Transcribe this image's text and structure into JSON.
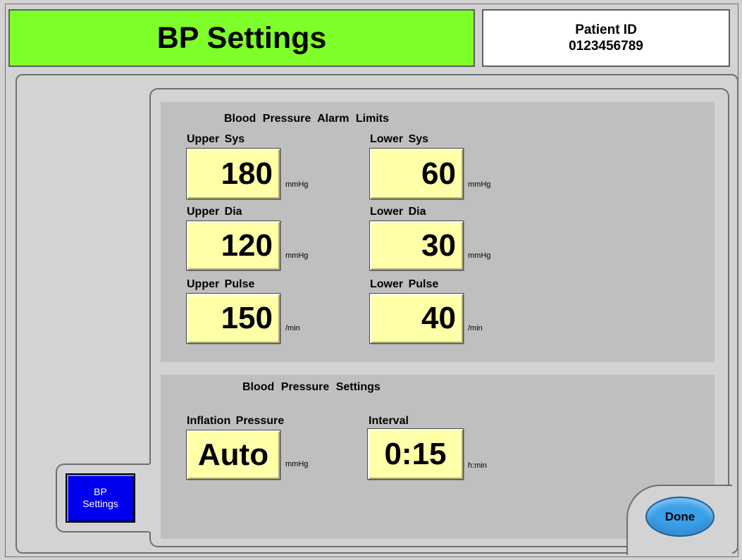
{
  "header": {
    "title": "BP Settings",
    "patient_id_label": "Patient ID",
    "patient_id_value": "0123456789"
  },
  "alarm_limits": {
    "section_title": "Blood  Pressure  Alarm  Limits",
    "upper_sys": {
      "label": "Upper Sys",
      "value": "180",
      "unit": "mmHg"
    },
    "lower_sys": {
      "label": "Lower Sys",
      "value": "60",
      "unit": "mmHg"
    },
    "upper_dia": {
      "label": "Upper Dia",
      "value": "120",
      "unit": "mmHg"
    },
    "lower_dia": {
      "label": "Lower Dia",
      "value": "30",
      "unit": "mmHg"
    },
    "upper_pulse": {
      "label": "Upper Pulse",
      "value": "150",
      "unit": "/min"
    },
    "lower_pulse": {
      "label": "Lower Pulse",
      "value": "40",
      "unit": "/min"
    }
  },
  "bp_settings": {
    "section_title": "Blood  Pressure  Settings",
    "inflation_pressure": {
      "label": "Inflation  Pressure",
      "value": "Auto",
      "unit": "mmHg"
    },
    "interval": {
      "label": "Interval",
      "value": "0:15",
      "unit": "h:min"
    }
  },
  "nav": {
    "bp_tab_line1": "BP",
    "bp_tab_line2": "Settings"
  },
  "actions": {
    "done_label": "Done"
  },
  "colors": {
    "title_bar": "#7fff2a",
    "value_field": "#ffffa8",
    "active_tab": "#0000ee",
    "done_button": "#3aa0ea",
    "panel_bg": "#bfbfbf",
    "window_bg": "#d3d3d3"
  }
}
